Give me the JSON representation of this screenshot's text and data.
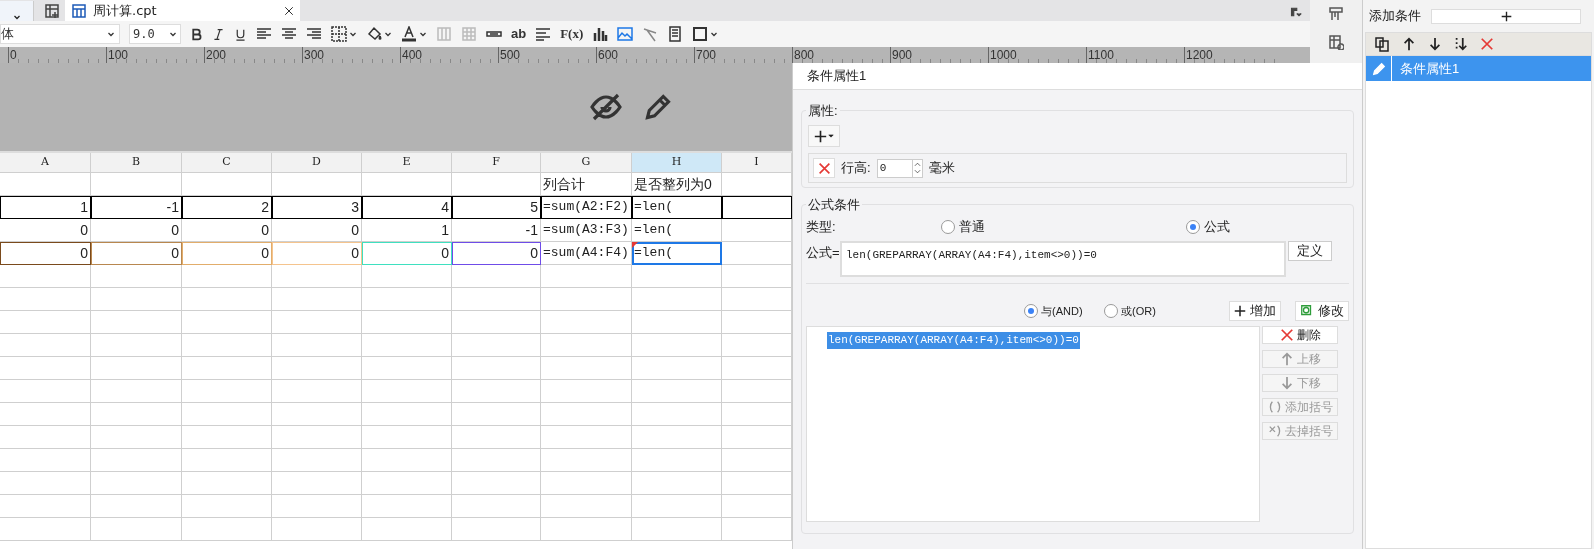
{
  "tabs": [
    {
      "label": "周计算.cpt",
      "selected": true
    }
  ],
  "toolbar": {
    "font": "体",
    "size": "9.0",
    "labels": [
      "ab",
      "F(x)"
    ]
  },
  "ruler": [
    "0",
    "100",
    "200",
    "300",
    "400",
    "500",
    "600",
    "700",
    "800",
    "900",
    "1000",
    "1100",
    "1200"
  ],
  "sheet": {
    "columns": [
      {
        "label": "A",
        "selected": false
      },
      {
        "label": "B",
        "selected": false
      },
      {
        "label": "C",
        "selected": false
      },
      {
        "label": "D",
        "selected": false
      },
      {
        "label": "E",
        "selected": false
      },
      {
        "label": "F",
        "selected": false
      },
      {
        "label": "G",
        "selected": false
      },
      {
        "label": "H",
        "selected": true
      },
      {
        "label": "I",
        "selected": false
      }
    ],
    "rows": [
      {
        "outlined": false,
        "cells": [
          {
            "selected": false
          },
          {
            "selected": false
          },
          {
            "selected": false
          },
          {
            "selected": false
          },
          {
            "selected": false
          },
          {
            "selected": false
          },
          {
            "text": "列合计",
            "kind": "text",
            "selected": false
          },
          {
            "text": "是否整列为0",
            "kind": "text",
            "selected": false
          }
        ]
      },
      {
        "outlined": true,
        "cells": [
          {
            "text": "1",
            "kind": "number",
            "selected": false
          },
          {
            "text": "-1",
            "kind": "number",
            "selected": false
          },
          {
            "text": "2",
            "kind": "number",
            "selected": false
          },
          {
            "text": "3",
            "kind": "number",
            "selected": false
          },
          {
            "text": "4",
            "kind": "number",
            "selected": false
          },
          {
            "text": "5",
            "kind": "number",
            "selected": false
          },
          {
            "text": "=sum(A2:F2)",
            "kind": "formula",
            "selected": false
          },
          {
            "text": "=len(",
            "kind": "formula",
            "selected": false
          }
        ]
      },
      {
        "outlined": false,
        "cells": [
          {
            "text": "0",
            "kind": "number",
            "selected": false
          },
          {
            "text": "0",
            "kind": "number",
            "selected": false
          },
          {
            "text": "0",
            "kind": "number",
            "selected": false
          },
          {
            "text": "0",
            "kind": "number",
            "selected": false
          },
          {
            "text": "1",
            "kind": "number",
            "selected": false
          },
          {
            "text": "-1",
            "kind": "number",
            "selected": false
          },
          {
            "text": "=sum(A3:F3)",
            "kind": "formula",
            "selected": false
          },
          {
            "text": "=len(",
            "kind": "formula",
            "selected": false
          }
        ]
      },
      {
        "outlined": false,
        "cells": [
          {
            "text": "0",
            "kind": "number",
            "selected": false,
            "color": "#7a4a1c"
          },
          {
            "text": "0",
            "kind": "number",
            "selected": false,
            "color": "#b8874f"
          },
          {
            "text": "0",
            "kind": "number",
            "selected": false,
            "color": "#e2ad6b"
          },
          {
            "text": "0",
            "kind": "number",
            "selected": false,
            "color": "#f5c48e"
          },
          {
            "text": "0",
            "kind": "number",
            "selected": false,
            "color": "#3fe0c0"
          },
          {
            "text": "0",
            "kind": "number",
            "selected": false,
            "color": "#6f4ce8"
          },
          {
            "text": "=sum(A4:F4)",
            "kind": "formula",
            "selected": false
          },
          {
            "text": "=len(",
            "kind": "formula",
            "selected": true,
            "flagged": true
          }
        ]
      }
    ]
  },
  "dialog": {
    "title": "条件属性1",
    "properties": {
      "title": "属性:",
      "row_label": "行高:",
      "row_value": "0",
      "unit": "毫米"
    },
    "formula_condition": {
      "title": "公式条件",
      "type_label": "类型:",
      "types": [
        {
          "label": "普通",
          "selected": false
        },
        {
          "label": "公式",
          "selected": true
        }
      ],
      "formula_label": "公式=",
      "formula": "len(GREPARRAY(ARRAY(A4:F4),item<>0))=0",
      "define_button": "定义",
      "logic": [
        {
          "label": "与(AND)",
          "selected": true
        },
        {
          "label": "或(OR)",
          "selected": false
        }
      ],
      "add_button": "增加",
      "modify_button": "修改",
      "conditions": [
        {
          "text": "len(GREPARRAY(ARRAY(A4:F4),item<>0))=0",
          "selected": true
        }
      ],
      "side_buttons": [
        {
          "kind": "delete",
          "label": "删除",
          "disabled": false
        },
        {
          "kind": "up",
          "label": "上移",
          "disabled": true
        },
        {
          "kind": "down",
          "label": "下移",
          "disabled": true
        },
        {
          "kind": "add-paren",
          "label": "添加括号",
          "disabled": true
        },
        {
          "kind": "remove-paren",
          "label": "去掉括号",
          "disabled": true
        }
      ]
    }
  },
  "side_panel": {
    "add_label": "添加条件",
    "items": [
      {
        "label": "条件属性1",
        "selected": true
      }
    ]
  }
}
